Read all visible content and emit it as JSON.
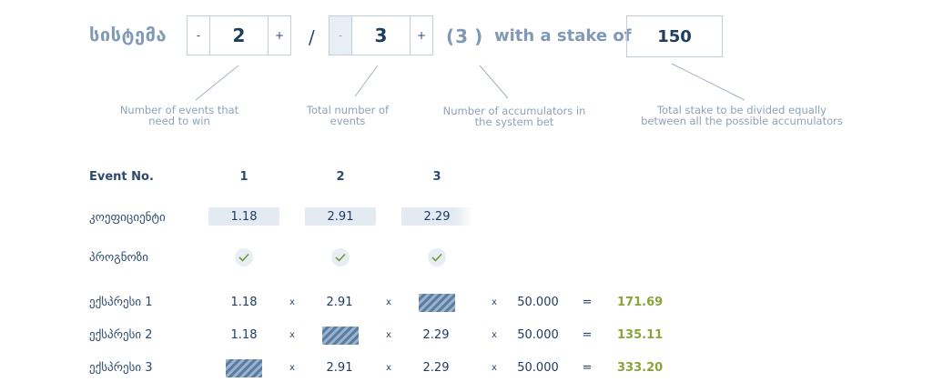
{
  "system": {
    "title": "სისტემა",
    "wins": {
      "minus": "-",
      "value": "2",
      "plus": "+"
    },
    "slash": "/",
    "total": {
      "minus": "-",
      "value": "3",
      "plus": "+"
    },
    "count_open": "(",
    "count_value": "3",
    "count_close": ")",
    "stake_label": "with a stake of",
    "stake_value": "150"
  },
  "hints": {
    "wins": "Number of events that need to win",
    "total": "Total number of events",
    "accumulators": "Number of accumulators in the system bet",
    "stake": "Total stake to be divided equally between all the possible accumulators"
  },
  "table": {
    "event_label": "Event No.",
    "events": [
      "1",
      "2",
      "3"
    ],
    "odds_label": "კოეფიციენტი",
    "odds": [
      "1.18",
      "2.91",
      "2.29"
    ],
    "prognosis_label": "პროგნოზი",
    "prognosis_icon": "check-icon",
    "multiply": "x",
    "equals": "=",
    "accumulators": [
      {
        "label": "ექსპრესი 1",
        "c1": "1.18",
        "c2": "2.91",
        "c3": null,
        "stake": "50.000",
        "result": "171.69"
      },
      {
        "label": "ექსპრესი 2",
        "c1": "1.18",
        "c2": null,
        "c3": "2.29",
        "stake": "50.000",
        "result": "135.11"
      },
      {
        "label": "ექსპრესი 3",
        "c1": null,
        "c2": "2.91",
        "c3": "2.29",
        "stake": "50.000",
        "result": "333.20"
      }
    ]
  },
  "colors": {
    "accent": "#8aa33a",
    "primary": "#1e3d61",
    "muted": "#8099b6"
  }
}
